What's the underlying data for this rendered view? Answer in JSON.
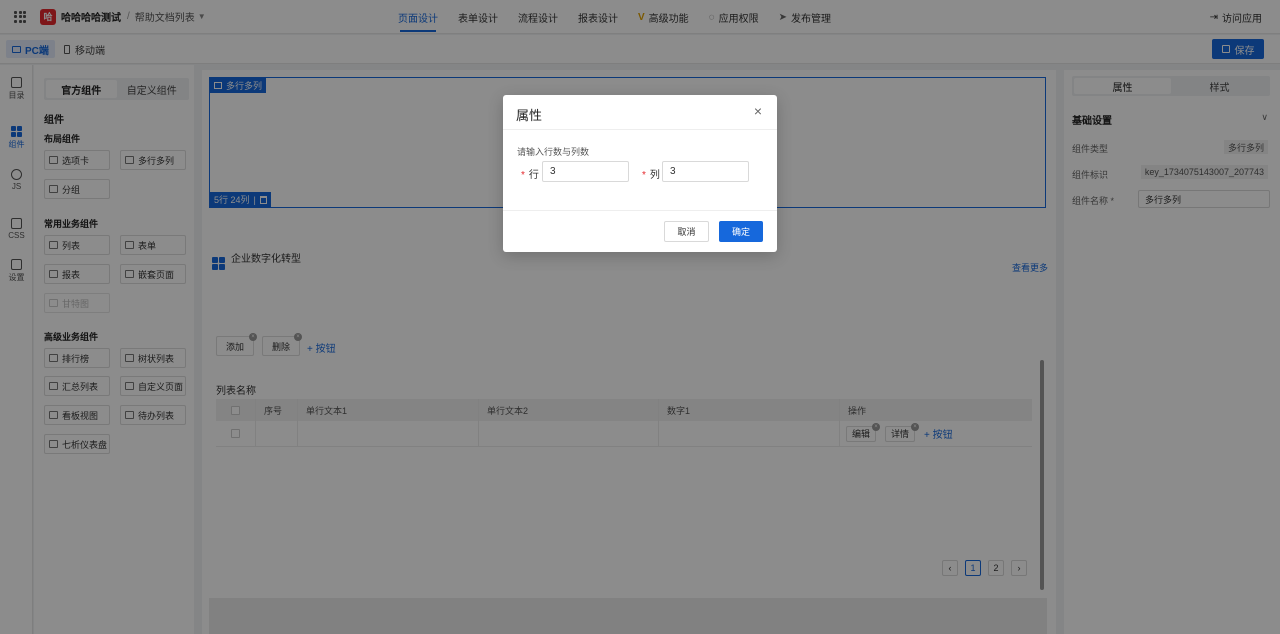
{
  "header": {
    "app_logo_text": "哈",
    "app_name": "哈哈哈哈测试",
    "crumb_sep": "/",
    "breadcrumb": "帮助文档列表",
    "nav": [
      {
        "label": "页面设计",
        "icon": "",
        "active": true
      },
      {
        "label": "表单设计",
        "icon": ""
      },
      {
        "label": "流程设计",
        "icon": ""
      },
      {
        "label": "报表设计",
        "icon": ""
      },
      {
        "label": "高级功能",
        "icon": "V"
      },
      {
        "label": "应用权限",
        "icon": "◌"
      },
      {
        "label": "发布管理",
        "icon": "➤"
      }
    ],
    "visit_label": "访问应用",
    "visit_icon": "⇥"
  },
  "subbar": {
    "pc_label": "PC端",
    "mobile_label": "移动端",
    "save_label": "保存"
  },
  "rail": [
    {
      "label": "目录"
    },
    {
      "label": "组件"
    },
    {
      "label": "JS"
    },
    {
      "label": "CSS"
    },
    {
      "label": "设置"
    }
  ],
  "components": {
    "tabs": [
      "官方组件",
      "自定义组件"
    ],
    "heading": "组件",
    "layout_title": "布局组件",
    "layout_items": [
      "选项卡",
      "多行多列",
      "分组"
    ],
    "common_title": "常用业务组件",
    "common_items": [
      "列表",
      "表单",
      "报表",
      "嵌套页面",
      "甘特图"
    ],
    "advanced_title": "高级业务组件",
    "advanced_items": [
      "排行榜",
      "树状列表",
      "汇总列表",
      "自定义页面",
      "看板视图",
      "待办列表",
      "七析仪表盘"
    ]
  },
  "canvas": {
    "sel_tag": "多行多列",
    "sel_bottom": "5行 24列",
    "sel_bottom_sep": "|",
    "doc_title": "企业数字化转型",
    "see_more": "查看更多",
    "add_btn": "添加",
    "del_btn": "删除",
    "add_button_link": "+ 按钮",
    "x_mark": "×",
    "list_title": "列表名称",
    "columns": [
      "",
      "序号",
      "单行文本1",
      "单行文本2",
      "数字1",
      "操作"
    ],
    "row_ops": [
      "编辑",
      "详情"
    ],
    "row_add_link": "+ 按钮",
    "pager": [
      "‹",
      "1",
      "2",
      "›"
    ]
  },
  "right_panel": {
    "tabs": [
      "属性",
      "样式"
    ],
    "section": "基础设置",
    "chevron": "∨",
    "type_label": "组件类型",
    "type_value": "多行多列",
    "id_label": "组件标识",
    "id_value": "key_1734075143007_207743",
    "name_label": "组件名称",
    "name_req": "*",
    "name_value": "多行多列"
  },
  "modal": {
    "title": "属性",
    "close": "×",
    "hint": "请输入行数与列数",
    "req_mark": "*",
    "row_label": "行",
    "row_value": "3",
    "col_label": "列",
    "col_value": "3",
    "cancel": "取消",
    "ok": "确定"
  }
}
